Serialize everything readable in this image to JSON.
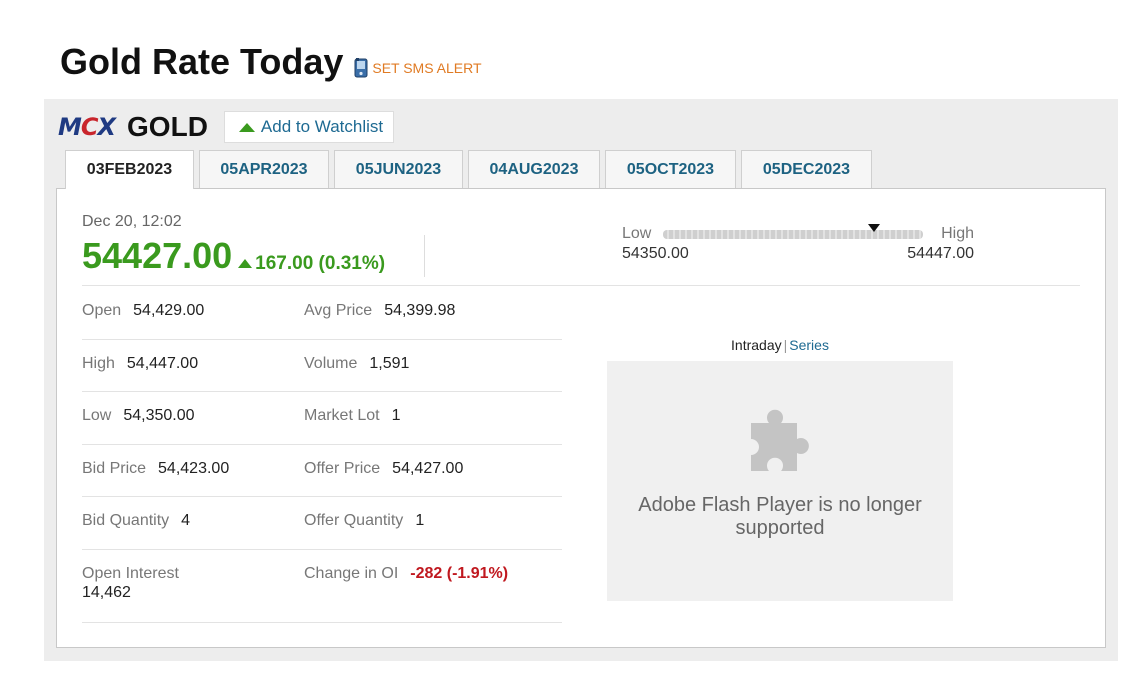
{
  "page": {
    "title": "Gold Rate Today",
    "sms_alert_label": "SET SMS ALERT"
  },
  "header": {
    "exchange_logo": "MCX",
    "commodity": "GOLD",
    "watchlist_label": "Add to Watchlist"
  },
  "tabs": [
    {
      "label": "03FEB2023",
      "active": true
    },
    {
      "label": "05APR2023",
      "active": false
    },
    {
      "label": "05JUN2023",
      "active": false
    },
    {
      "label": "04AUG2023",
      "active": false
    },
    {
      "label": "05OCT2023",
      "active": false
    },
    {
      "label": "05DEC2023",
      "active": false
    }
  ],
  "quote": {
    "timestamp": "Dec 20, 12:02",
    "last_price": "54427.00",
    "change": "167.00 (0.31%)"
  },
  "range": {
    "low_label": "Low",
    "high_label": "High",
    "low_value": "54350.00",
    "high_value": "54447.00",
    "current_fraction": 0.81
  },
  "stats": [
    {
      "l_label": "Open",
      "l_value": "54,429.00",
      "r_label": "Avg Price",
      "r_value": "54,399.98"
    },
    {
      "l_label": "High",
      "l_value": "54,447.00",
      "r_label": "Volume",
      "r_value": "1,591"
    },
    {
      "l_label": "Low",
      "l_value": "54,350.00",
      "r_label": "Market Lot",
      "r_value": "1"
    },
    {
      "l_label": "Bid Price",
      "l_value": "54,423.00",
      "r_label": "Offer Price",
      "r_value": "54,427.00"
    },
    {
      "l_label": "Bid Quantity",
      "l_value": "4",
      "r_label": "Offer Quantity",
      "r_value": "1"
    },
    {
      "l_label": "Open Interest",
      "l_value": "14,462",
      "r_label": "Change in OI",
      "r_value": "-282 (-1.91%)"
    }
  ],
  "chart": {
    "intraday_label": "Intraday",
    "separator": "|",
    "series_label": "Series",
    "flash_message": "Adobe Flash Player is no longer supported"
  },
  "colors": {
    "positive": "#3a9a1e",
    "negative": "#c0181f",
    "link": "#1e6a92",
    "sms": "#e07b24"
  },
  "icons": {
    "sms": "phone-icon",
    "watchlist": "triangle-up-icon",
    "change": "triangle-up-icon",
    "range_marker": "triangle-down-icon",
    "flash": "puzzle-piece-icon"
  }
}
